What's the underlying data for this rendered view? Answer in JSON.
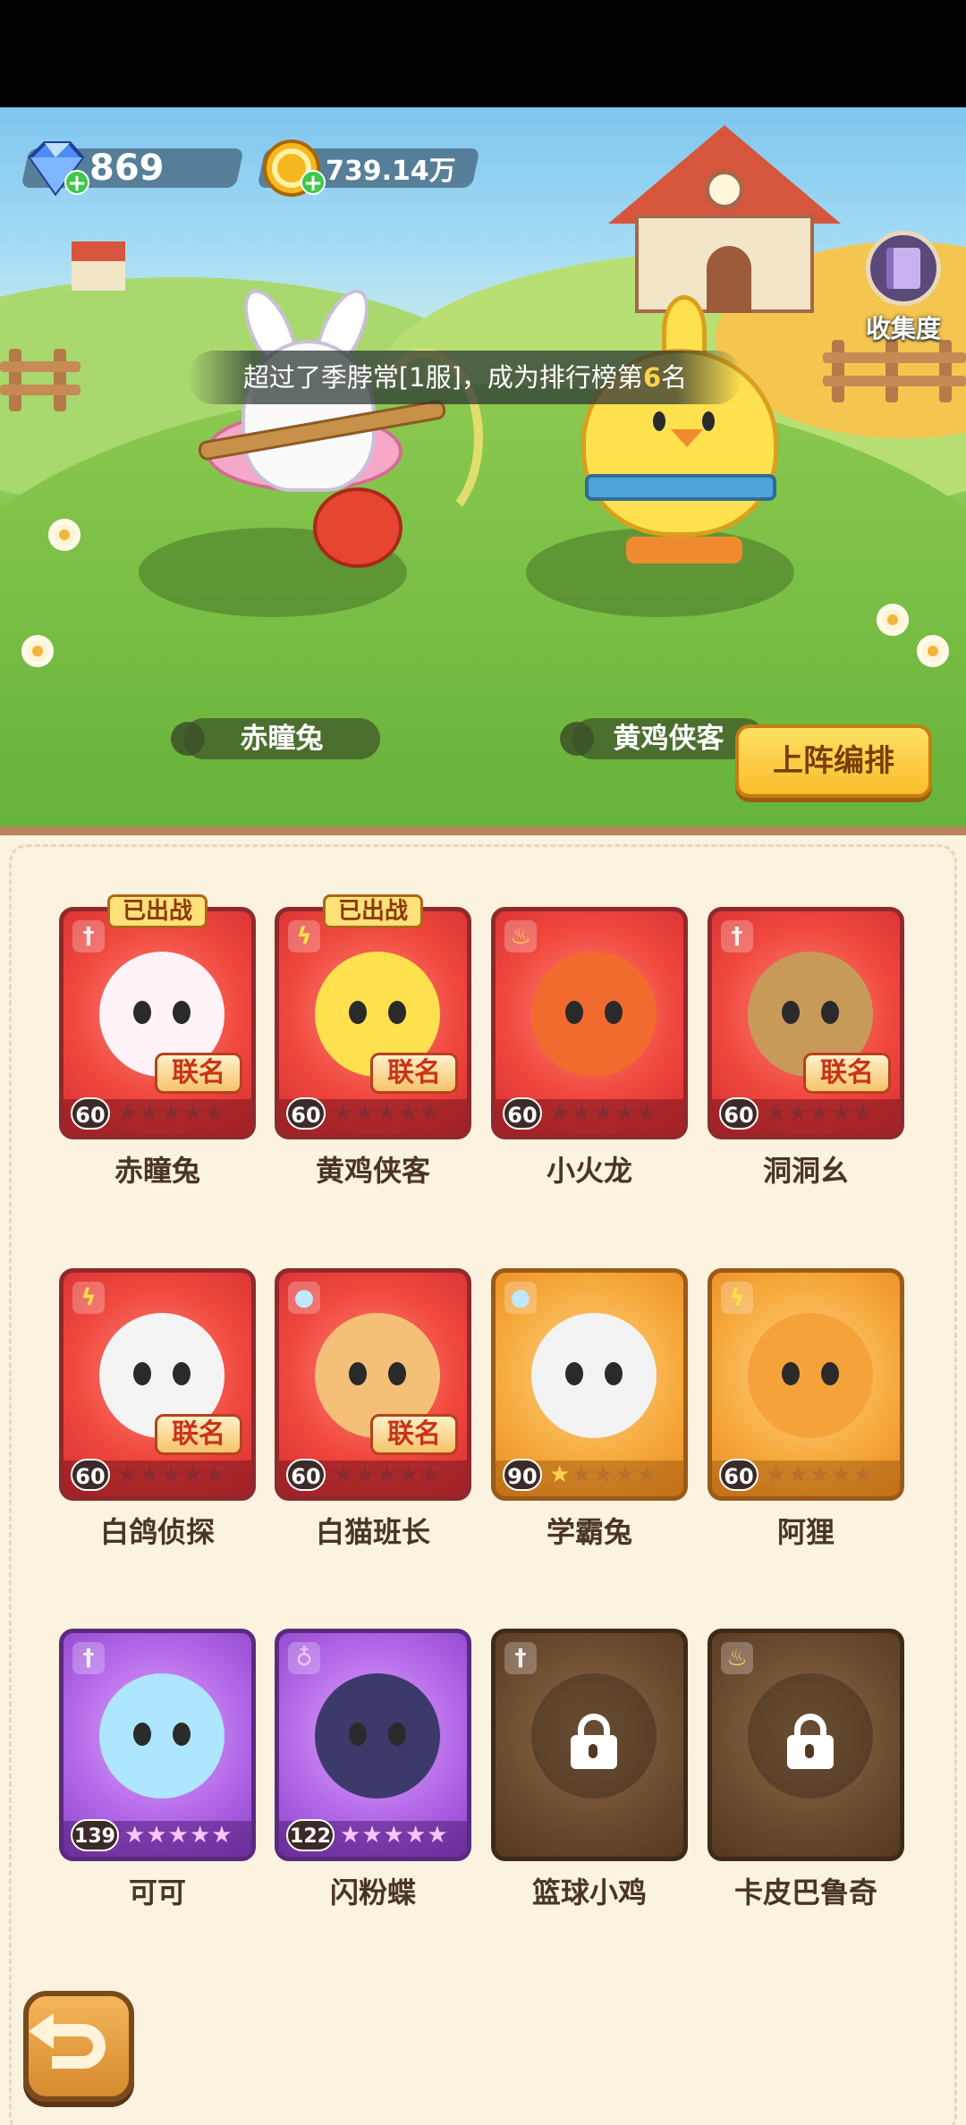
{
  "currency": {
    "gems": "869",
    "coins": "739.14万"
  },
  "collection": {
    "label": "收集度"
  },
  "rank_banner": {
    "prefix": "超过了季脖常[1服]，成为排行榜第",
    "rank": "6",
    "suffix": "名"
  },
  "team": {
    "left_name": "赤瞳兔",
    "right_name": "黄鸡侠客"
  },
  "lineup_button": "上阵编排",
  "deployed_label": "已出战",
  "collab_label": "联名",
  "cards": [
    {
      "name": "赤瞳兔",
      "level": "60",
      "element": "sword-icon",
      "rarity": "red",
      "deployed": true,
      "collab": true,
      "stars_on": 0,
      "locked": false
    },
    {
      "name": "黄鸡侠客",
      "level": "60",
      "element": "thunder-icon",
      "rarity": "red",
      "deployed": true,
      "collab": true,
      "stars_on": 0,
      "locked": false
    },
    {
      "name": "小火龙",
      "level": "60",
      "element": "fire-icon",
      "rarity": "red",
      "deployed": false,
      "collab": false,
      "stars_on": 0,
      "locked": false
    },
    {
      "name": "洞洞幺",
      "level": "60",
      "element": "sword-icon",
      "rarity": "red",
      "deployed": false,
      "collab": true,
      "stars_on": 0,
      "locked": false
    },
    {
      "name": "白鸽侦探",
      "level": "60",
      "element": "thunder-icon",
      "rarity": "red",
      "deployed": false,
      "collab": true,
      "stars_on": 0,
      "locked": false
    },
    {
      "name": "白猫班长",
      "level": "60",
      "element": "water-icon",
      "rarity": "red",
      "deployed": false,
      "collab": true,
      "stars_on": 0,
      "locked": false
    },
    {
      "name": "学霸兔",
      "level": "90",
      "element": "water-icon",
      "rarity": "orange",
      "deployed": false,
      "collab": false,
      "stars_on": 1,
      "locked": false
    },
    {
      "name": "阿狸",
      "level": "60",
      "element": "thunder-icon",
      "rarity": "orange",
      "deployed": false,
      "collab": false,
      "stars_on": 0,
      "locked": false
    },
    {
      "name": "可可",
      "level": "139",
      "element": "sword-icon",
      "rarity": "purple",
      "deployed": false,
      "collab": false,
      "stars_on": 5,
      "locked": false
    },
    {
      "name": "闪粉蝶",
      "level": "122",
      "element": "potion-icon",
      "rarity": "purple",
      "deployed": false,
      "collab": false,
      "stars_on": 4,
      "locked": false
    },
    {
      "name": "篮球小鸡",
      "level": "",
      "element": "sword-icon",
      "rarity": "locked",
      "deployed": false,
      "collab": false,
      "stars_on": 0,
      "locked": true
    },
    {
      "name": "卡皮巴鲁奇",
      "level": "",
      "element": "fire-icon",
      "rarity": "locked",
      "deployed": false,
      "collab": false,
      "stars_on": 0,
      "locked": true
    }
  ],
  "colors": {
    "panel_bg": "#fbf2df",
    "red_card": "#f0483e",
    "orange_card": "#f6a83a",
    "purple_card": "#b064e6",
    "locked_card": "#6b4b2f",
    "button_gold": "#f9bd2c"
  }
}
